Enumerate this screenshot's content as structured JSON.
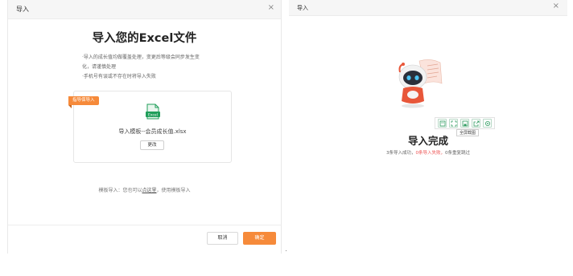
{
  "left_dialog": {
    "header_title": "导入",
    "close_glyph": "×",
    "main_title": "导入您的Excel文件",
    "notes": [
      "·导入的成长值均做覆盖处理，变更后等级会同步发生变",
      "化，请谨慎处理",
      "·手机号有误或不存在时将导入失败"
    ],
    "upload": {
      "ribbon": "指导保导入",
      "icon_label": "Excel",
      "file_name": "导入模板--会员成长值.xlsx",
      "change_label": "更改"
    },
    "template_line": {
      "prefix": "模板导入：您也可以",
      "link": "点这里",
      "suffix": "，使用模板导入"
    },
    "footer": {
      "cancel_label": "取消",
      "confirm_label": "确定"
    }
  },
  "right_dialog": {
    "header_title": "导入",
    "close_glyph": "×",
    "toolbar_icons": [
      "image-icon",
      "fullscreen-icon",
      "save-icon",
      "share-icon",
      "settings-icon"
    ],
    "tooltip": "全屏截图",
    "done_title": "导入完成",
    "stats": {
      "success": "3条导入成功，",
      "fail": "0条导入失败，",
      "dup": "0条重复跳过"
    }
  },
  "colors": {
    "accent": "#f68a3a",
    "excel_green": "#1f9e5a",
    "fail_red": "#e55555"
  }
}
